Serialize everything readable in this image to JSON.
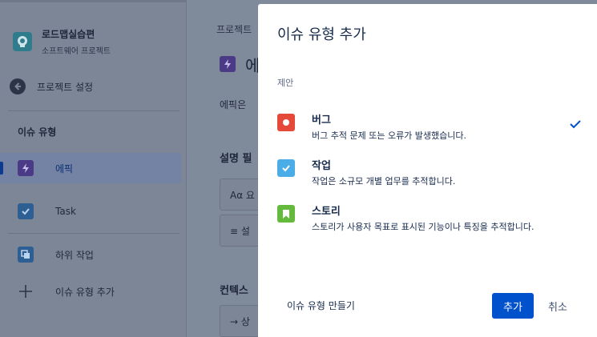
{
  "sidebar": {
    "project_name": "로드맵실습편",
    "project_sub": "소프트웨어 프로젝트",
    "back_label": "프로젝트 설정",
    "section_title": "이슈 유형",
    "items": [
      {
        "label": "에픽",
        "icon": "lightning-icon",
        "color": "#5a4aa0"
      },
      {
        "label": "Task",
        "icon": "checkbox-icon",
        "color": "#2d76c2"
      },
      {
        "label": "하위 작업",
        "icon": "subtask-icon",
        "color": "#2d76c2"
      },
      {
        "label": "이슈 유형 추가",
        "icon": "plus-icon",
        "color": "#2c3547"
      }
    ]
  },
  "main": {
    "breadcrumb": "프로젝트",
    "title": "에",
    "desc": "에픽은 ",
    "fields_heading": "설명 필",
    "field1": "Aα  요",
    "field2": "≡  설",
    "context_heading": "컨텍스",
    "field3": "→  상"
  },
  "modal": {
    "title": "이슈 유형 추가",
    "suggestion_label": "제안",
    "options": [
      {
        "title": "버그",
        "desc": "버그 추적 문제 또는 오류가 발생했습니다.",
        "icon": "bug-icon",
        "color": "#e5493a",
        "selected": true
      },
      {
        "title": "작업",
        "desc": "작업은 소규모 개별 업무를 추적합니다.",
        "icon": "task-check-icon",
        "color": "#4bade8",
        "selected": false
      },
      {
        "title": "스토리",
        "desc": "스토리가 사용자 목표로 표시된 기능이나 특징을 추적합니다.",
        "icon": "story-bookmark-icon",
        "color": "#63ba3c",
        "selected": false
      }
    ],
    "create_link": "이슈 유형 만들기",
    "add_button": "추가",
    "cancel_button": "취소",
    "accent": "#0052cc"
  }
}
